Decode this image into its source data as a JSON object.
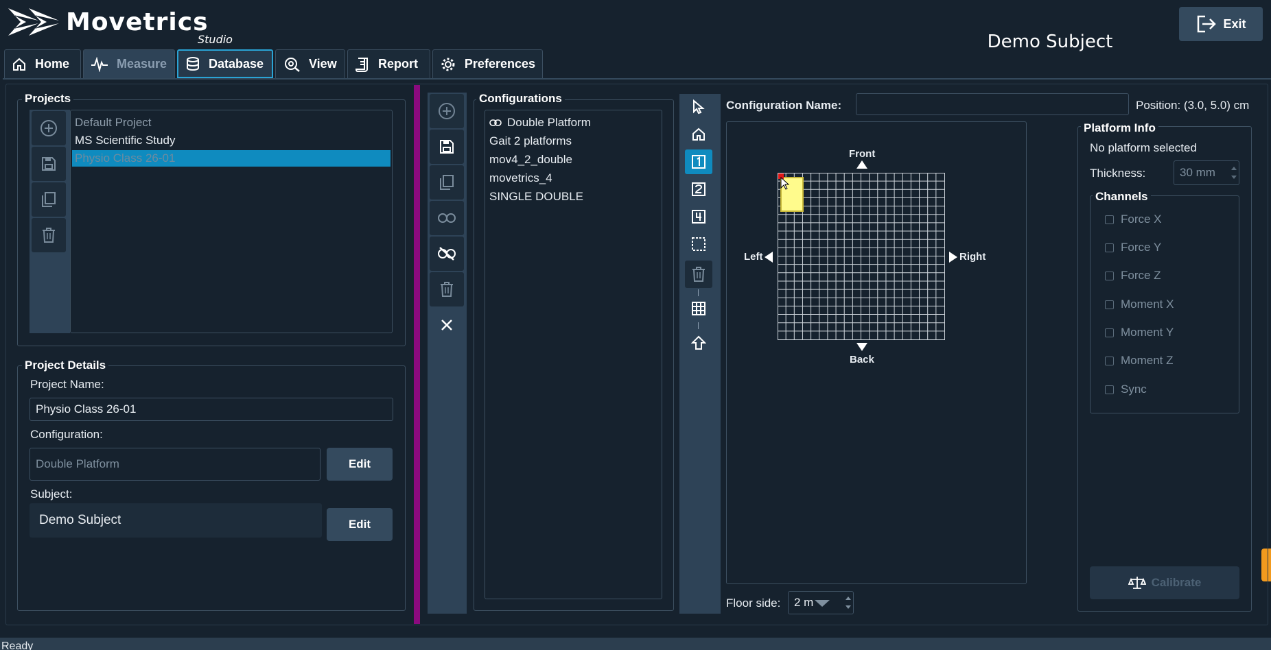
{
  "app": {
    "logo_text": "Movetrics",
    "logo_sub": "Studio",
    "subject_title": "Demo Subject",
    "exit_label": "Exit"
  },
  "tabs": [
    {
      "label": "Home",
      "icon": "home-icon"
    },
    {
      "label": "Measure",
      "icon": "waveform-icon"
    },
    {
      "label": "Database",
      "icon": "database-icon"
    },
    {
      "label": "View",
      "icon": "eye-icon"
    },
    {
      "label": "Report",
      "icon": "report-icon"
    },
    {
      "label": "Preferences",
      "icon": "gear-icon"
    }
  ],
  "projects": {
    "title": "Projects",
    "items": [
      "Default Project",
      "MS Scientific Study",
      "Physio Class 26-01"
    ],
    "selected": "Physio Class 26-01"
  },
  "details": {
    "title": "Project Details",
    "name_label": "Project Name:",
    "name_value": "Physio Class 26-01",
    "config_label": "Configuration:",
    "config_value": "Double Platform",
    "config_edit": "Edit",
    "subject_label": "Subject:",
    "subject_value": "Demo Subject",
    "subject_edit": "Edit"
  },
  "configurations": {
    "title": "Configurations",
    "items": [
      "Double Platform",
      "Gait 2 platforms",
      "mov4_2_double",
      "movetrics_4",
      "SINGLE DOUBLE"
    ],
    "linked": "Double Platform"
  },
  "editor": {
    "config_name_label": "Configuration Name:",
    "config_name_value": "",
    "position_text": "Position: (3.0, 5.0) cm",
    "front": "Front",
    "back": "Back",
    "left": "Left",
    "right": "Right",
    "floor_side_label": "Floor side:",
    "floor_side_value": "2 m"
  },
  "platform_info": {
    "title": "Platform Info",
    "status": "No platform selected",
    "thickness_label": "Thickness:",
    "thickness_value": "30 mm",
    "channels_title": "Channels",
    "channels": [
      "Force X",
      "Force Y",
      "Force Z",
      "Moment X",
      "Moment Y",
      "Moment Z",
      "Sync"
    ],
    "calibrate_label": "Calibrate"
  },
  "status_bar": "Ready",
  "colors": {
    "accent": "#0f8bbf",
    "splitter": "#8b0a7e",
    "bg": "#16222e",
    "platform": "#fffb8c"
  }
}
